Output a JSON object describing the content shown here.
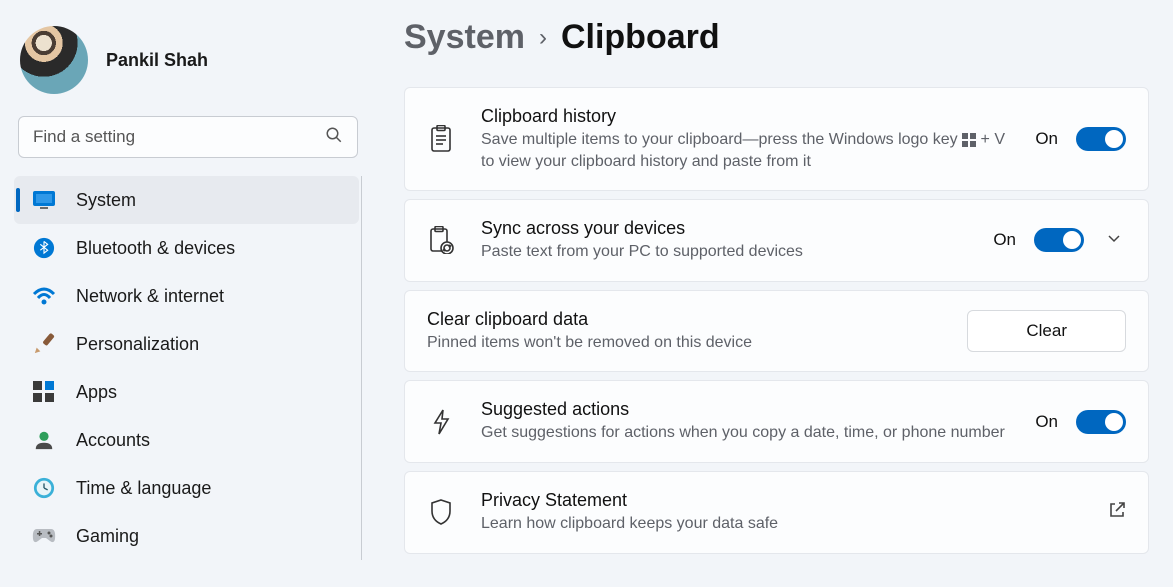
{
  "profile": {
    "name": "Pankil Shah"
  },
  "search": {
    "placeholder": "Find a setting"
  },
  "nav": {
    "items": [
      {
        "label": "System",
        "icon": "system",
        "active": true
      },
      {
        "label": "Bluetooth & devices",
        "icon": "bluetooth"
      },
      {
        "label": "Network & internet",
        "icon": "wifi"
      },
      {
        "label": "Personalization",
        "icon": "personalization"
      },
      {
        "label": "Apps",
        "icon": "apps"
      },
      {
        "label": "Accounts",
        "icon": "accounts"
      },
      {
        "label": "Time & language",
        "icon": "time"
      },
      {
        "label": "Gaming",
        "icon": "gaming"
      }
    ]
  },
  "breadcrumb": {
    "parent": "System",
    "current": "Clipboard"
  },
  "cards": {
    "history": {
      "title": "Clipboard history",
      "desc_a": "Save multiple items to your clipboard—press the Windows logo key ",
      "desc_b": " + V to view your clipboard history and paste from it",
      "state": "On"
    },
    "sync": {
      "title": "Sync across your devices",
      "desc": "Paste text from your PC to supported devices",
      "state": "On"
    },
    "clear": {
      "title": "Clear clipboard data",
      "desc": "Pinned items won't be removed on this device",
      "button": "Clear"
    },
    "suggested": {
      "title": "Suggested actions",
      "desc": "Get suggestions for actions when you copy a date, time, or phone number",
      "state": "On"
    },
    "privacy": {
      "title": "Privacy Statement",
      "desc": "Learn how clipboard keeps your data safe"
    }
  }
}
